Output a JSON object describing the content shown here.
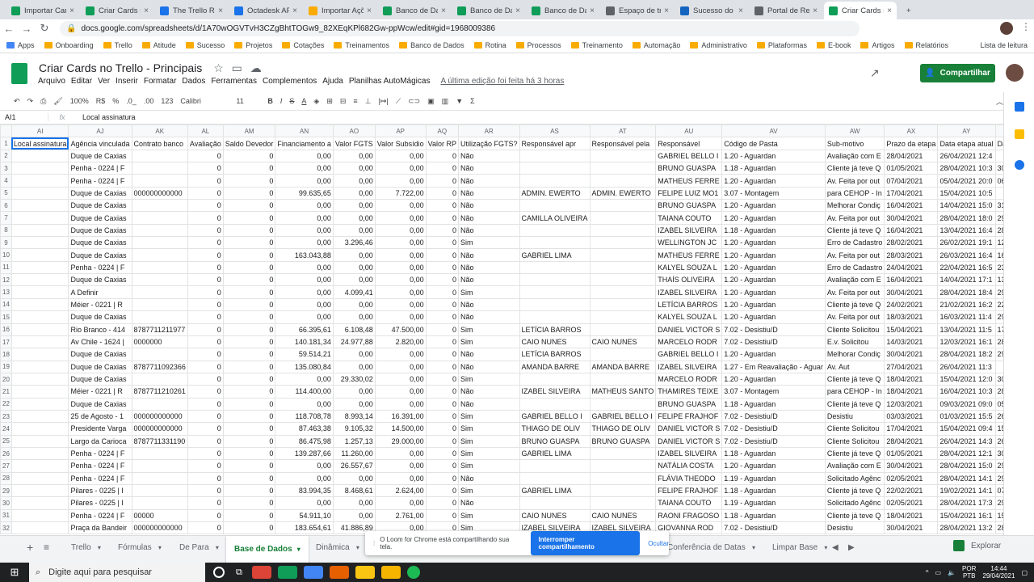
{
  "browser_tabs": [
    {
      "label": "Importar Card",
      "color": "#0f9d58"
    },
    {
      "label": "Criar Cards no",
      "color": "#0f9d58"
    },
    {
      "label": "The Trello RES",
      "color": "#1a73e8"
    },
    {
      "label": "Octadesk API",
      "color": "#1a73e8"
    },
    {
      "label": "Importar Açõe",
      "color": "#f9ab00"
    },
    {
      "label": "Banco de Dad",
      "color": "#0f9d58"
    },
    {
      "label": "Banco de Dad",
      "color": "#0f9d58"
    },
    {
      "label": "Banco de Dad",
      "color": "#0f9d58"
    },
    {
      "label": "Espaço de tra",
      "color": "#5f6368"
    },
    {
      "label": "Sucesso do C",
      "color": "#1565c0"
    },
    {
      "label": "Portal de Rep",
      "color": "#5f6368"
    },
    {
      "label": "Criar Cards no",
      "color": "#0f9d58"
    }
  ],
  "url": "docs.google.com/spreadsheets/d/1A70wOGVTvH3CZgBhtTOGw9_82XEqKPl682Gw-ppWcw/edit#gid=1968009386",
  "bookmarks": [
    "Apps",
    "Onboarding",
    "Trello",
    "Atitude",
    "Sucesso",
    "Projetos",
    "Cotações",
    "Treinamentos",
    "Banco de Dados",
    "Rotina",
    "Processos",
    "Treinamento",
    "Automação",
    "Administrativo",
    "Plataformas",
    "E-book",
    "Artigos",
    "Relatórios"
  ],
  "reading_list": "Lista de leitura",
  "doc": {
    "title": "Criar Cards no Trello - Principais",
    "last_edit": "A última edição foi feita há 3 horas",
    "share": "Compartilhar"
  },
  "menus": [
    "Arquivo",
    "Editar",
    "Ver",
    "Inserir",
    "Formatar",
    "Dados",
    "Ferramentas",
    "Complementos",
    "Ajuda",
    "Planilhas AutoMágicas"
  ],
  "toolbar": {
    "zoom": "100%",
    "currency": "R$",
    "percent": "%",
    "dec1": ".0_",
    ".00": ".00",
    "fmt": "123",
    "font": "Calibri",
    "size": "11"
  },
  "formula_bar": {
    "cell": "AI1",
    "fx": "fx",
    "value": "Local assinatura"
  },
  "columns": [
    "AI",
    "AJ",
    "AK",
    "AL",
    "AM",
    "AN",
    "AO",
    "AP",
    "AQ",
    "AR",
    "AS",
    "AT",
    "AU",
    "AV",
    "AW",
    "AX",
    "AY",
    "AZ"
  ],
  "rows": [
    [
      "Local assinatura",
      "Agência vinculada",
      "Contrato banco",
      "Avaliação",
      "Saldo Devedor",
      "Financiamento a",
      "Valor FGTS",
      "Valor Subsídio",
      "Valor RP",
      "Utilização FGTS?",
      "Responsável apr",
      "Responsável pela",
      "Responsável",
      "Código de Pasta",
      "Sub-motivo",
      "Prazo da etapa",
      "Data etapa atual",
      "Data retorno c"
    ],
    [
      "",
      "Duque de Caxias",
      "",
      "0",
      "0",
      "0,00",
      "0,00",
      "0,00",
      "0",
      "Não",
      "",
      "",
      "GABRIEL BELLO I",
      "1.20 - Aguardan",
      "Avaliação com E",
      "28/04/2021",
      "26/04/2021 12:4",
      ""
    ],
    [
      "",
      "Penha - 0224 | F",
      "",
      "0",
      "0",
      "0,00",
      "0,00",
      "0,00",
      "0",
      "Não",
      "",
      "",
      "BRUNO GUASPA",
      "1.18 - Aguardan",
      "Cliente já teve Q",
      "01/05/2021",
      "28/04/2021 10:3",
      "30/04/202"
    ],
    [
      "",
      "Penha - 0224 | F",
      "",
      "0",
      "0",
      "0,00",
      "0,00",
      "0,00",
      "0",
      "Não",
      "",
      "",
      "MATHEUS FERRE",
      "1.20 - Aguardan",
      "Av. Feita por out",
      "07/04/2021",
      "05/04/2021 20:0",
      "06/05/202"
    ],
    [
      "",
      "Duque de Caxias",
      "000000000000",
      "0",
      "0",
      "99.635,65",
      "0,00",
      "7.722,00",
      "0",
      "Não",
      "ADMIN. EWERTO",
      "ADMIN. EWERTO",
      "FELIPE LUIZ MO1",
      "3.07 - Montagem",
      "para CEHOP - In",
      "17/04/2021",
      "15/04/2021 10:5",
      ""
    ],
    [
      "",
      "Duque de Caxias",
      "",
      "0",
      "0",
      "0,00",
      "0,00",
      "0,00",
      "0",
      "Não",
      "",
      "",
      "BRUNO GUASPA",
      "1.20 - Aguardan",
      "Melhorar Condiç",
      "16/04/2021",
      "14/04/2021 15:0",
      "31/08/202"
    ],
    [
      "",
      "Duque de Caxias",
      "",
      "0",
      "0",
      "0,00",
      "0,00",
      "0,00",
      "0",
      "Não",
      "CAMILLA OLIVEIRA",
      "",
      "TAIANA COUTO",
      "1.20 - Aguardan",
      "Av. Feita por out",
      "30/04/2021",
      "28/04/2021 18:0",
      "29/04/202"
    ],
    [
      "",
      "Duque de Caxias",
      "",
      "0",
      "0",
      "0,00",
      "0,00",
      "0,00",
      "0",
      "Não",
      "",
      "",
      "IZABEL SILVEIRA",
      "1.18 - Aguardan",
      "Cliente já teve Q",
      "16/04/2021",
      "13/04/2021 16:4",
      "28/04/202"
    ],
    [
      "",
      "Duque de Caxias",
      "",
      "0",
      "0",
      "0,00",
      "3.296,46",
      "0,00",
      "0",
      "Sim",
      "",
      "",
      "WELLINGTON JC",
      "1.20 - Aguardan",
      "Erro de Cadastro",
      "28/02/2021",
      "26/02/2021 19:1",
      "12/05/202"
    ],
    [
      "",
      "Duque de Caxias",
      "",
      "0",
      "0",
      "163.043,88",
      "0,00",
      "0,00",
      "0",
      "Não",
      "GABRIEL LIMA",
      "",
      "MATHEUS FERRE",
      "1.20 - Aguardan",
      "Av. Feita por out",
      "28/03/2021",
      "26/03/2021 16:4",
      "16/08/202"
    ],
    [
      "",
      "Penha - 0224 | F",
      "",
      "0",
      "0",
      "0,00",
      "0,00",
      "0,00",
      "0",
      "Não",
      "",
      "",
      "KALYEL SOUZA L",
      "1.20 - Aguardan",
      "Erro de Cadastro",
      "24/04/2021",
      "22/04/2021 16:5",
      "23/04/202"
    ],
    [
      "",
      "Duque de Caxias",
      "",
      "0",
      "0",
      "0,00",
      "0,00",
      "0,00",
      "0",
      "Não",
      "",
      "",
      "THAÍS OLIVEIRA",
      "1.20 - Aguardan",
      "Avaliação com E",
      "16/04/2021",
      "14/04/2021 17:1",
      "13/05/202"
    ],
    [
      "",
      "A Definir",
      "",
      "0",
      "0",
      "0,00",
      "4.099,41",
      "0,00",
      "0",
      "Sim",
      "",
      "",
      "IZABEL SILVEIRA",
      "1.20 - Aguardan",
      "Av. Feita por out",
      "30/04/2021",
      "28/04/2021 18:4",
      "29/04/202"
    ],
    [
      "",
      "Méier - 0221 | R",
      "",
      "0",
      "0",
      "0,00",
      "0,00",
      "0,00",
      "0",
      "Não",
      "",
      "",
      "LETÍCIA BARROS",
      "1.20 - Aguardan",
      "Cliente já teve Q",
      "24/02/2021",
      "21/02/2021 16:2",
      "22/04/202"
    ],
    [
      "",
      "Duque de Caxias",
      "",
      "0",
      "0",
      "0,00",
      "0,00",
      "0,00",
      "0",
      "Não",
      "",
      "",
      "KALYEL SOUZA L",
      "1.20 - Aguardan",
      "Av. Feita por out",
      "18/03/2021",
      "16/03/2021 11:4",
      "29/08/202"
    ],
    [
      "",
      "Rio Branco - 414",
      "8787711211977",
      "0",
      "0",
      "66.395,61",
      "6.108,48",
      "47.500,00",
      "0",
      "Sim",
      "LETÍCIA BARROS",
      "",
      "DANIEL VICTOR S",
      "7.02 - Desistiu/D",
      "Cliente Solicitou",
      "15/04/2021",
      "13/04/2021 11:5",
      "17/04/202"
    ],
    [
      "",
      "Av Chile - 1624 |",
      "0000000",
      "0",
      "0",
      "140.181,34",
      "24.977,88",
      "2.820,00",
      "0",
      "Sim",
      "CAIO NUNES",
      "CAIO NUNES",
      "MARCELO RODR",
      "7.02 - Desistiu/D",
      "E.v. Solicitou",
      "14/03/2021",
      "12/03/2021 16:1",
      "28/04/202"
    ],
    [
      "",
      "Duque de Caxias",
      "",
      "0",
      "0",
      "59.514,21",
      "0,00",
      "0,00",
      "0",
      "Não",
      "LETÍCIA BARROS",
      "",
      "GABRIEL BELLO I",
      "1.20 - Aguardan",
      "Melhorar Condiç",
      "30/04/2021",
      "28/04/2021 18:2",
      "29/04/202"
    ],
    [
      "",
      "Duque de Caxias",
      "8787711092366",
      "0",
      "0",
      "135.080,84",
      "0,00",
      "0,00",
      "0",
      "Não",
      "AMANDA BARRE",
      "AMANDA BARRE",
      "IZABEL SILVEIRA",
      "1.27 - Em Reavaliação - Aguar",
      "Av. Aut",
      "27/04/2021",
      "26/04/2021 11:3",
      ""
    ],
    [
      "",
      "Duque de Caxias",
      "",
      "0",
      "0",
      "0,00",
      "29.330,02",
      "0,00",
      "0",
      "Sim",
      "",
      "",
      "MARCELO RODR",
      "1.20 - Aguardan",
      "Cliente já teve Q",
      "18/04/2021",
      "15/04/2021 12:0",
      "30/04/202"
    ],
    [
      "",
      "Méier - 0221 | R",
      "8787711210261",
      "0",
      "0",
      "114.400,00",
      "0,00",
      "0,00",
      "0",
      "Não",
      "IZABEL SILVEIRA",
      "MATHEUS SANTO",
      "THAMIRES TEIXE",
      "3.07 - Montagem",
      "para CEHOP - In",
      "18/04/2021",
      "16/04/2021 10:3",
      "28/04/202"
    ],
    [
      "",
      "Duque de Caxias",
      "",
      "0",
      "0",
      "0,00",
      "0,00",
      "0,00",
      "0",
      "Não",
      "",
      "",
      "BRUNO GUASPA",
      "1.18 - Aguardan",
      "Cliente já teve Q",
      "12/03/2021",
      "09/03/2021 09:0",
      "05/07/202"
    ],
    [
      "",
      "25 de Agosto - 1",
      "000000000000",
      "0",
      "0",
      "118.708,78",
      "8.993,14",
      "16.391,00",
      "0",
      "Sim",
      "GABRIEL BELLO I",
      "GABRIEL BELLO I",
      "FELIPE FRAJHOF",
      "7.02 - Desistiu/D",
      "Desistiu",
      "03/03/2021",
      "01/03/2021 15:5",
      "26/04/202"
    ],
    [
      "",
      "Presidente Varga",
      "000000000000",
      "0",
      "0",
      "87.463,38",
      "9.105,32",
      "14.500,00",
      "0",
      "Sim",
      "THIAGO DE OLIV",
      "THIAGO DE OLIV",
      "DANIEL VICTOR S",
      "7.02 - Desistiu/D",
      "Cliente Solicitou",
      "17/04/2021",
      "15/04/2021 09:4",
      "15/04/202"
    ],
    [
      "",
      "Largo da Carioca",
      "8787711331190",
      "0",
      "0",
      "86.475,98",
      "1.257,13",
      "29.000,00",
      "0",
      "Sim",
      "BRUNO GUASPA",
      "BRUNO GUASPA",
      "DANIEL VICTOR S",
      "7.02 - Desistiu/D",
      "Cliente Solicitou",
      "28/04/2021",
      "26/04/2021 14:3",
      "26/04/202"
    ],
    [
      "",
      "Penha - 0224 | F",
      "",
      "0",
      "0",
      "139.287,66",
      "11.260,00",
      "0,00",
      "0",
      "Sim",
      "GABRIEL LIMA",
      "",
      "IZABEL SILVEIRA",
      "1.18 - Aguardan",
      "Cliente já teve Q",
      "01/05/2021",
      "28/04/2021 12:1",
      "30/04/202"
    ],
    [
      "",
      "Penha - 0224 | F",
      "",
      "0",
      "0",
      "0,00",
      "26.557,67",
      "0,00",
      "0",
      "Sim",
      "",
      "",
      "NATÁLIA COSTA",
      "1.20 - Aguardan",
      "Avaliação com E",
      "30/04/2021",
      "28/04/2021 15:0",
      "29/04/202"
    ],
    [
      "",
      "Penha - 0224 | F",
      "",
      "0",
      "0",
      "0,00",
      "0,00",
      "0,00",
      "0",
      "Não",
      "",
      "",
      "FLÁVIA THEODO",
      "1.19 - Aguardan",
      "Solicitado Agênc",
      "02/05/2021",
      "28/04/2021 14:1",
      "29/04/202"
    ],
    [
      "",
      "Pilares - 0225 | I",
      "",
      "0",
      "0",
      "83.994,35",
      "8.468,61",
      "2.624,00",
      "0",
      "Sim",
      "GABRIEL LIMA",
      "",
      "FELIPE FRAJHOF",
      "1.18 - Aguardan",
      "Cliente já teve Q",
      "22/02/2021",
      "19/02/2021 14:1",
      "07/04/202"
    ],
    [
      "",
      "Pilares - 0225 | I",
      "",
      "0",
      "0",
      "0,00",
      "0,00",
      "0,00",
      "0",
      "Não",
      "",
      "",
      "TAIANA COUTO",
      "1.19 - Aguardan",
      "Solicitado Agênc",
      "02/05/2021",
      "28/04/2021 17:3",
      "29/04/202"
    ],
    [
      "",
      "Penha - 0224 | F",
      "00000",
      "0",
      "0",
      "54.911,10",
      "0,00",
      "2.761,00",
      "0",
      "Sim",
      "CAIO NUNES",
      "CAIO NUNES",
      "RAONI FRAGOSO",
      "1.18 - Aguardan",
      "Cliente já teve Q",
      "18/04/2021",
      "15/04/2021 16:1",
      "15/04/202"
    ],
    [
      "",
      "Praça da Bandeir",
      "000000000000",
      "0",
      "0",
      "183.654,61",
      "41.886,89",
      "0,00",
      "0",
      "Sim",
      "IZABEL SILVEIRA",
      "IZABEL SILVEIRA",
      "GIOVANNA ROD",
      "7.02 - Desistiu/D",
      "Desistiu",
      "30/04/2021",
      "28/04/2021 13:2",
      "28/04/202"
    ]
  ],
  "sheet_tabs": [
    "Trello",
    "Fórmulas",
    "De Para",
    "Base de Dados",
    "Dinâmica",
    "Conferência de Datas",
    "Limpar Base"
  ],
  "active_sheet": "Base de Dados",
  "explore": "Explorar",
  "loom": {
    "text": "O Loom for Chrome está compartilhando sua tela.",
    "stop": "Interromper compartilhamento",
    "hide": "Ocultar"
  },
  "taskbar": {
    "search": "Digite aqui para pesquisar",
    "lang": "POR",
    "layout": "PTB",
    "time": "14:44",
    "date": "29/04/2021"
  }
}
